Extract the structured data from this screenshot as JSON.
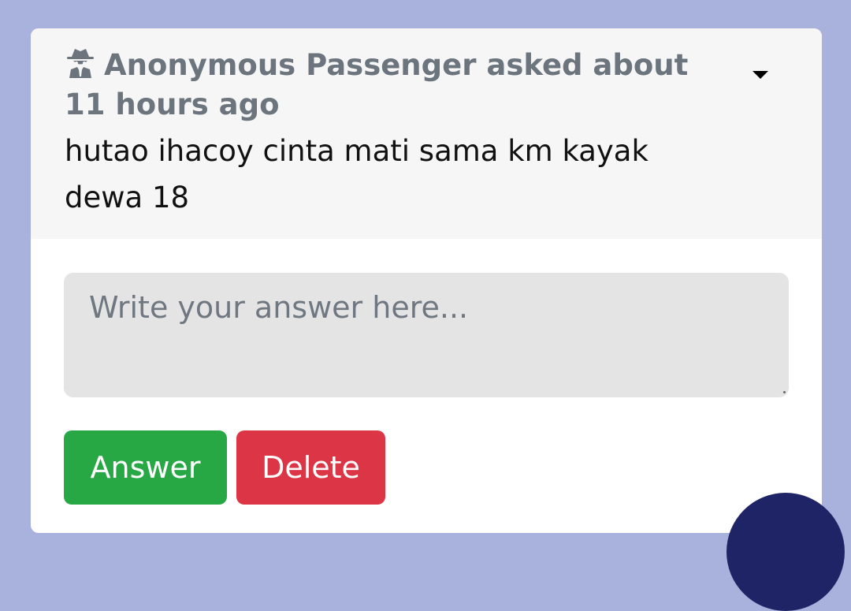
{
  "question": {
    "asker_line": "Anonymous Passenger asked about 11 hours ago",
    "asker_icon": "user-secret-icon",
    "text": "hutao ihacoy cinta mati sama km kayak dewa 18",
    "dropdown_icon": "caret-down-icon"
  },
  "answer_form": {
    "placeholder": "Write your answer here...",
    "value": ""
  },
  "actions": {
    "answer_label": "Answer",
    "delete_label": "Delete"
  },
  "colors": {
    "background": "#a9b1dd",
    "header_bg": "#f6f6f7",
    "muted_text": "#6c757d",
    "answer_button": "#28a745",
    "delete_button": "#dc3545",
    "fab": "#1e2466"
  }
}
